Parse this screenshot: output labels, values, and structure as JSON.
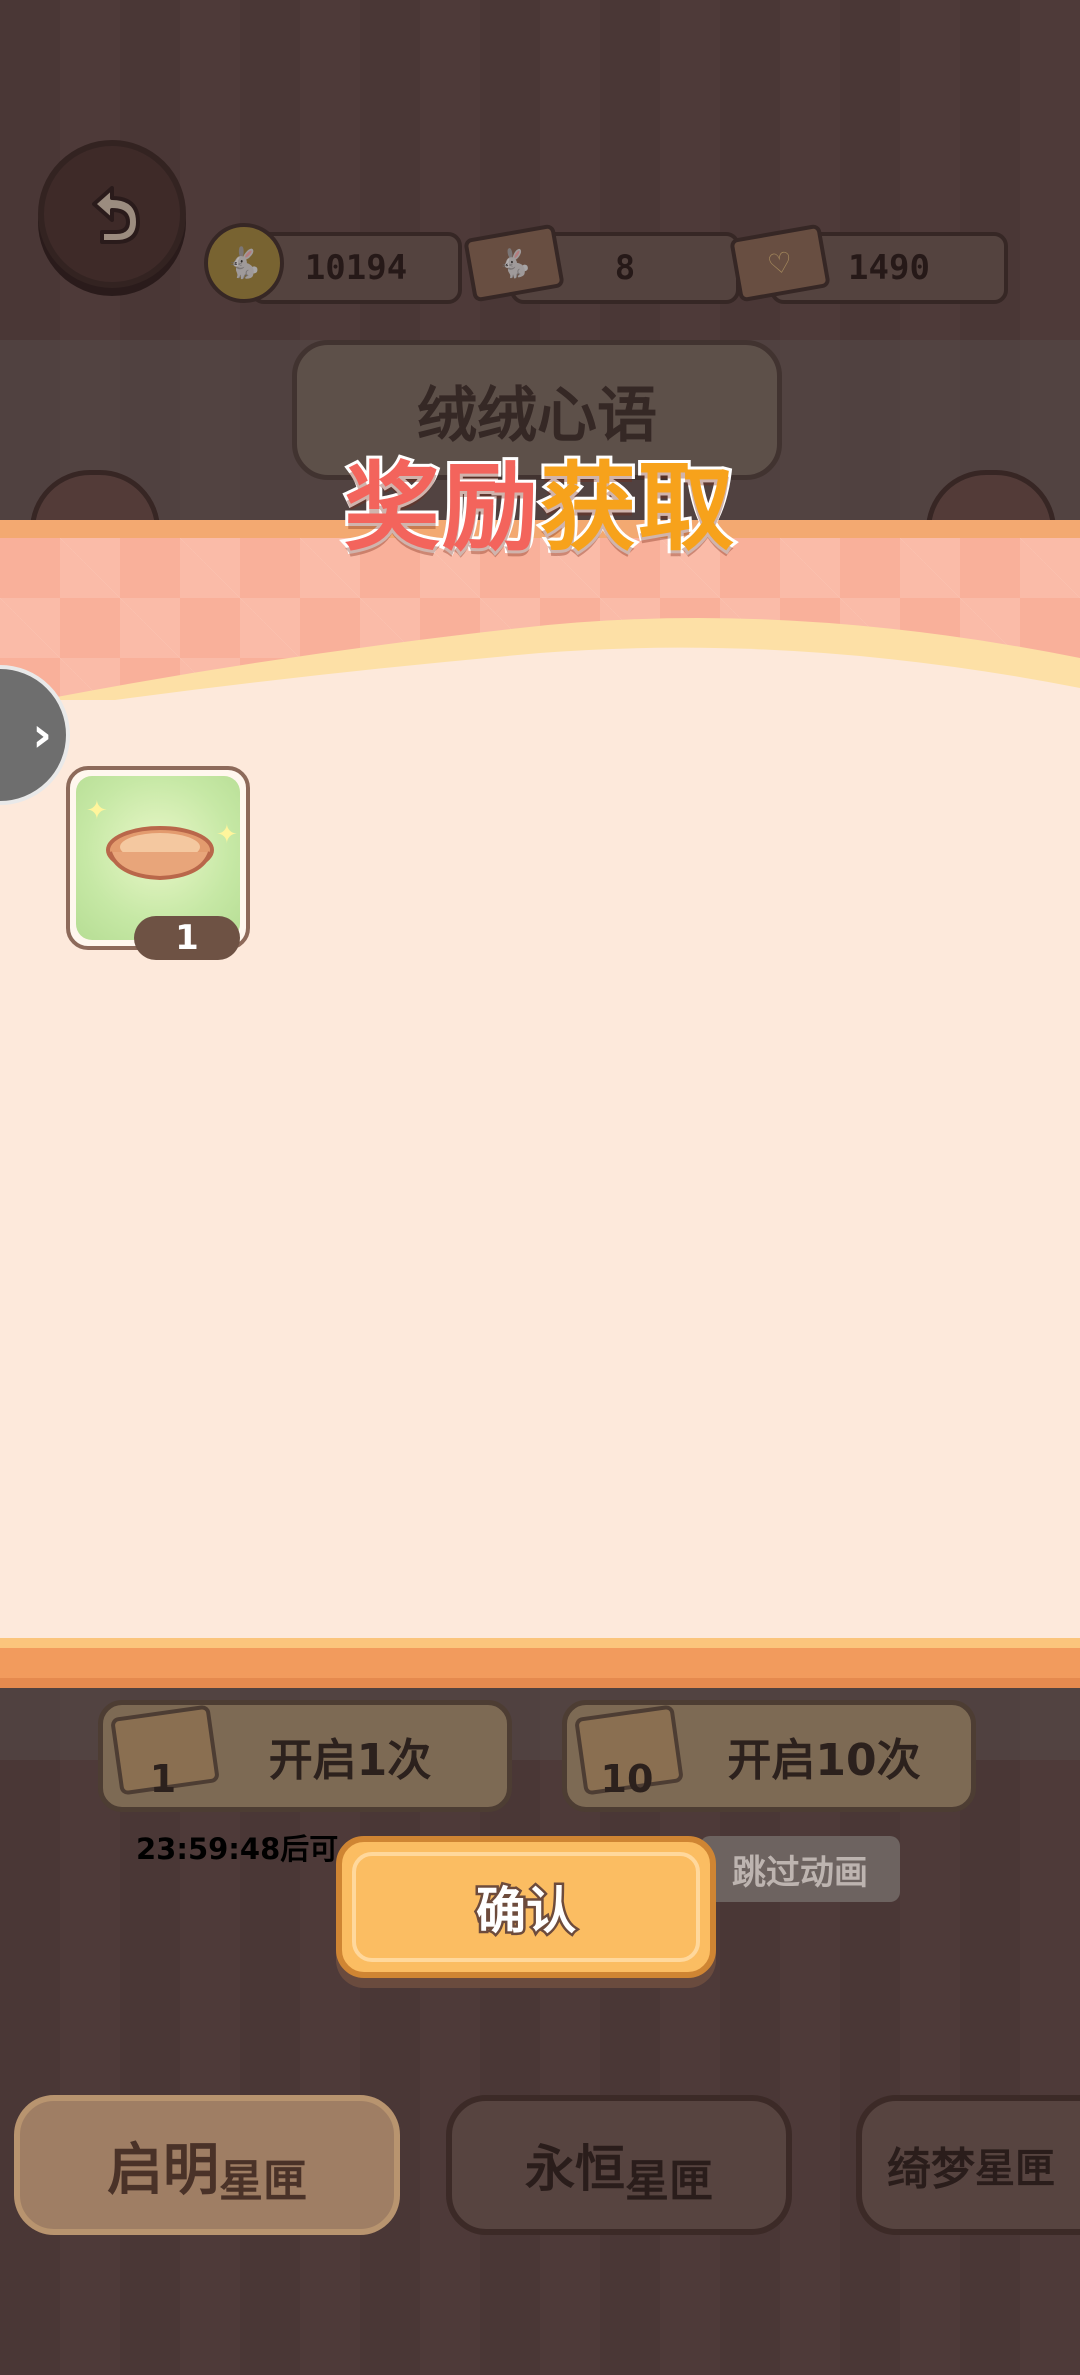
{
  "header": {
    "currencies": [
      {
        "name": "coin",
        "value": "10194"
      },
      {
        "name": "rabbit-ticket",
        "value": "8"
      },
      {
        "name": "heart-ticket",
        "value": "1490"
      }
    ],
    "title": "绒绒心语"
  },
  "modal": {
    "title_part1": "奖励",
    "title_part2": "获取",
    "rewards": [
      {
        "icon": "pie-crust-icon",
        "count": "1"
      }
    ],
    "confirm_label": "确认"
  },
  "background_controls": {
    "open_once": {
      "label": "开启1次",
      "cost": "1"
    },
    "open_ten": {
      "label": "开启10次",
      "cost": "10"
    },
    "timer_text": "23:59:48后可",
    "skip_label": "跳过动画"
  },
  "bottom_tabs": [
    {
      "label_main": "启明",
      "label_sub": "星匣",
      "active": true
    },
    {
      "label_main": "永恒",
      "label_sub": "星匣",
      "active": false
    },
    {
      "label_main": "绮梦",
      "label_sub": "星匣",
      "active": false
    }
  ],
  "colors": {
    "title_red": "#f3645c",
    "title_orange": "#f7a21b",
    "modal_body": "#fde9db",
    "confirm_button": "#fbbd62"
  }
}
